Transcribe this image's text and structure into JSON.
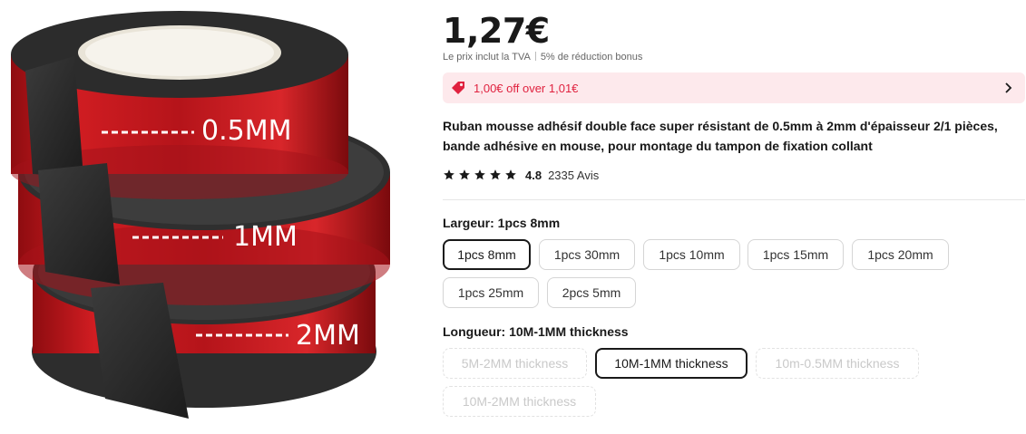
{
  "image": {
    "labels": [
      "0.5MM",
      "1MM",
      "2MM"
    ],
    "tape_color": "#c8171b",
    "foam_color": "#2a2a2a"
  },
  "price": {
    "value": "1,27€",
    "tax_note": "Le prix inclut la TVA",
    "bonus_note": "5% de réduction bonus"
  },
  "coupon": {
    "text": "1,00€ off over 1,01€",
    "icon": "tag-icon",
    "chevron": "chevron-right-icon",
    "accent": "#e0223f",
    "background": "#fde9ec"
  },
  "product": {
    "title": "Ruban mousse adhésif double face super résistant de 0.5mm à 2mm d'épaisseur 2/1 pièces, bande adhésive en mouse, pour montage du tampon de fixation collant"
  },
  "rating": {
    "stars": 5,
    "value": "4.8",
    "reviews": "2335 Avis"
  },
  "width_option": {
    "label": "Largeur: 1pcs 8mm",
    "options": [
      "1pcs 8mm",
      "1pcs 30mm",
      "1pcs 10mm",
      "1pcs 15mm",
      "1pcs 20mm",
      "1pcs 25mm",
      "2pcs 5mm"
    ],
    "selected": "1pcs 8mm"
  },
  "length_option": {
    "label": "Longueur: 10M-1MM thickness",
    "options": [
      "5M-2MM thickness",
      "10M-1MM thickness",
      "10m-0.5MM thickness",
      "10M-2MM thickness"
    ],
    "selected": "10M-1MM thickness",
    "disabled": [
      "5M-2MM thickness",
      "10m-0.5MM thickness",
      "10M-2MM thickness"
    ]
  }
}
